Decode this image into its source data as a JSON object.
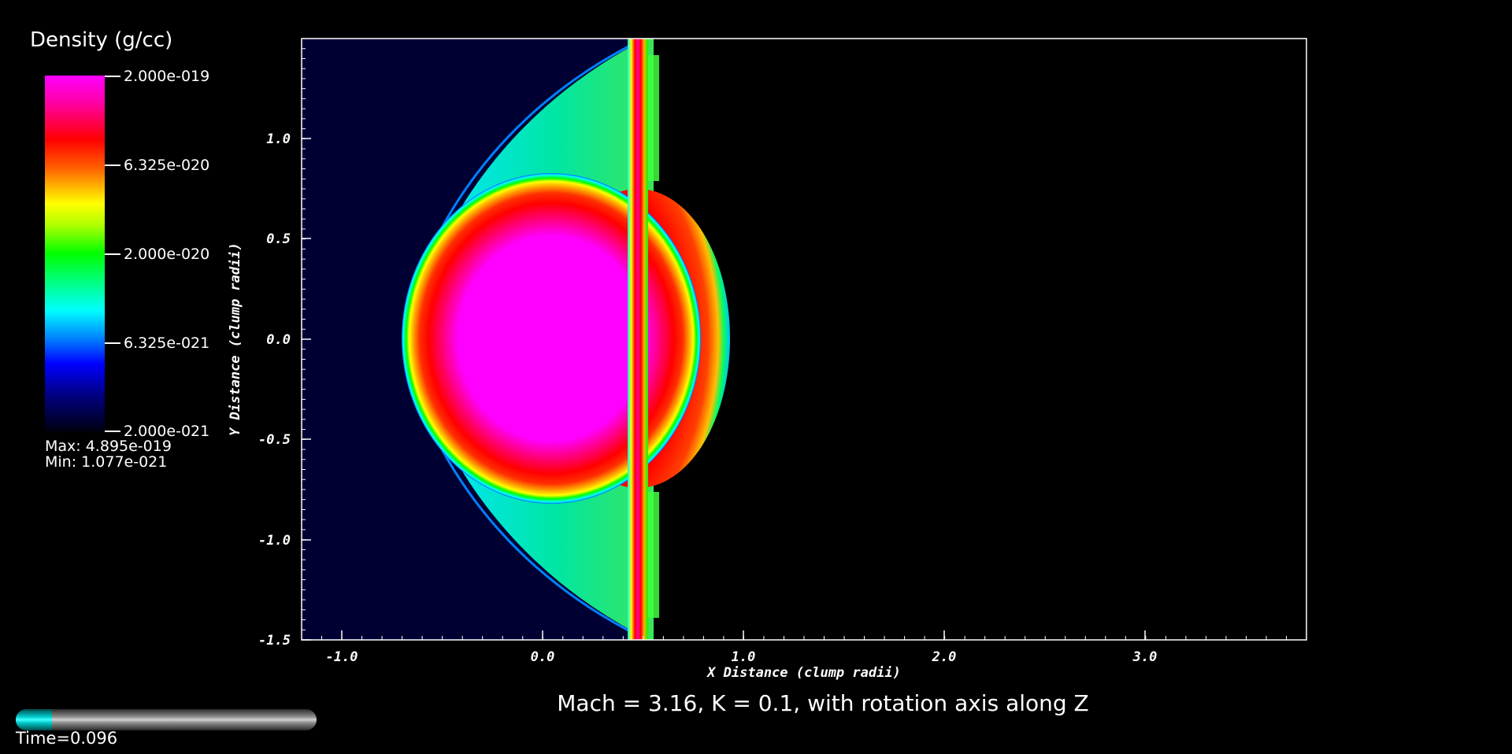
{
  "legend": {
    "title": "Density (g/cc)",
    "tick_labels": [
      "2.000e-019",
      "6.325e-020",
      "2.000e-020",
      "6.325e-021",
      "2.000e-021"
    ],
    "max_label": "Max:  4.895e-019",
    "min_label": "Min:  1.077e-021"
  },
  "plot": {
    "title": "Mach = 3.16, K = 0.1, with rotation axis along Z",
    "x_axis_title": "X Distance (clump radii)",
    "y_axis_title": "Y Distance (clump radii)",
    "x_tick_labels": [
      "-1.0",
      "0.0",
      "1.0",
      "2.0",
      "3.0"
    ],
    "y_tick_labels": [
      "1.0",
      "0.5",
      "0.0",
      "-0.5",
      "-1.0",
      "-1.5"
    ],
    "x_range": [
      -1.2,
      3.8
    ],
    "y_range": [
      -1.5,
      1.5
    ]
  },
  "time": {
    "label": "Time=0.096",
    "progress": 0.12
  },
  "colors": {
    "background": "#000000",
    "ambient_medium": "#000033",
    "slider_fill": "#00ffff"
  }
}
